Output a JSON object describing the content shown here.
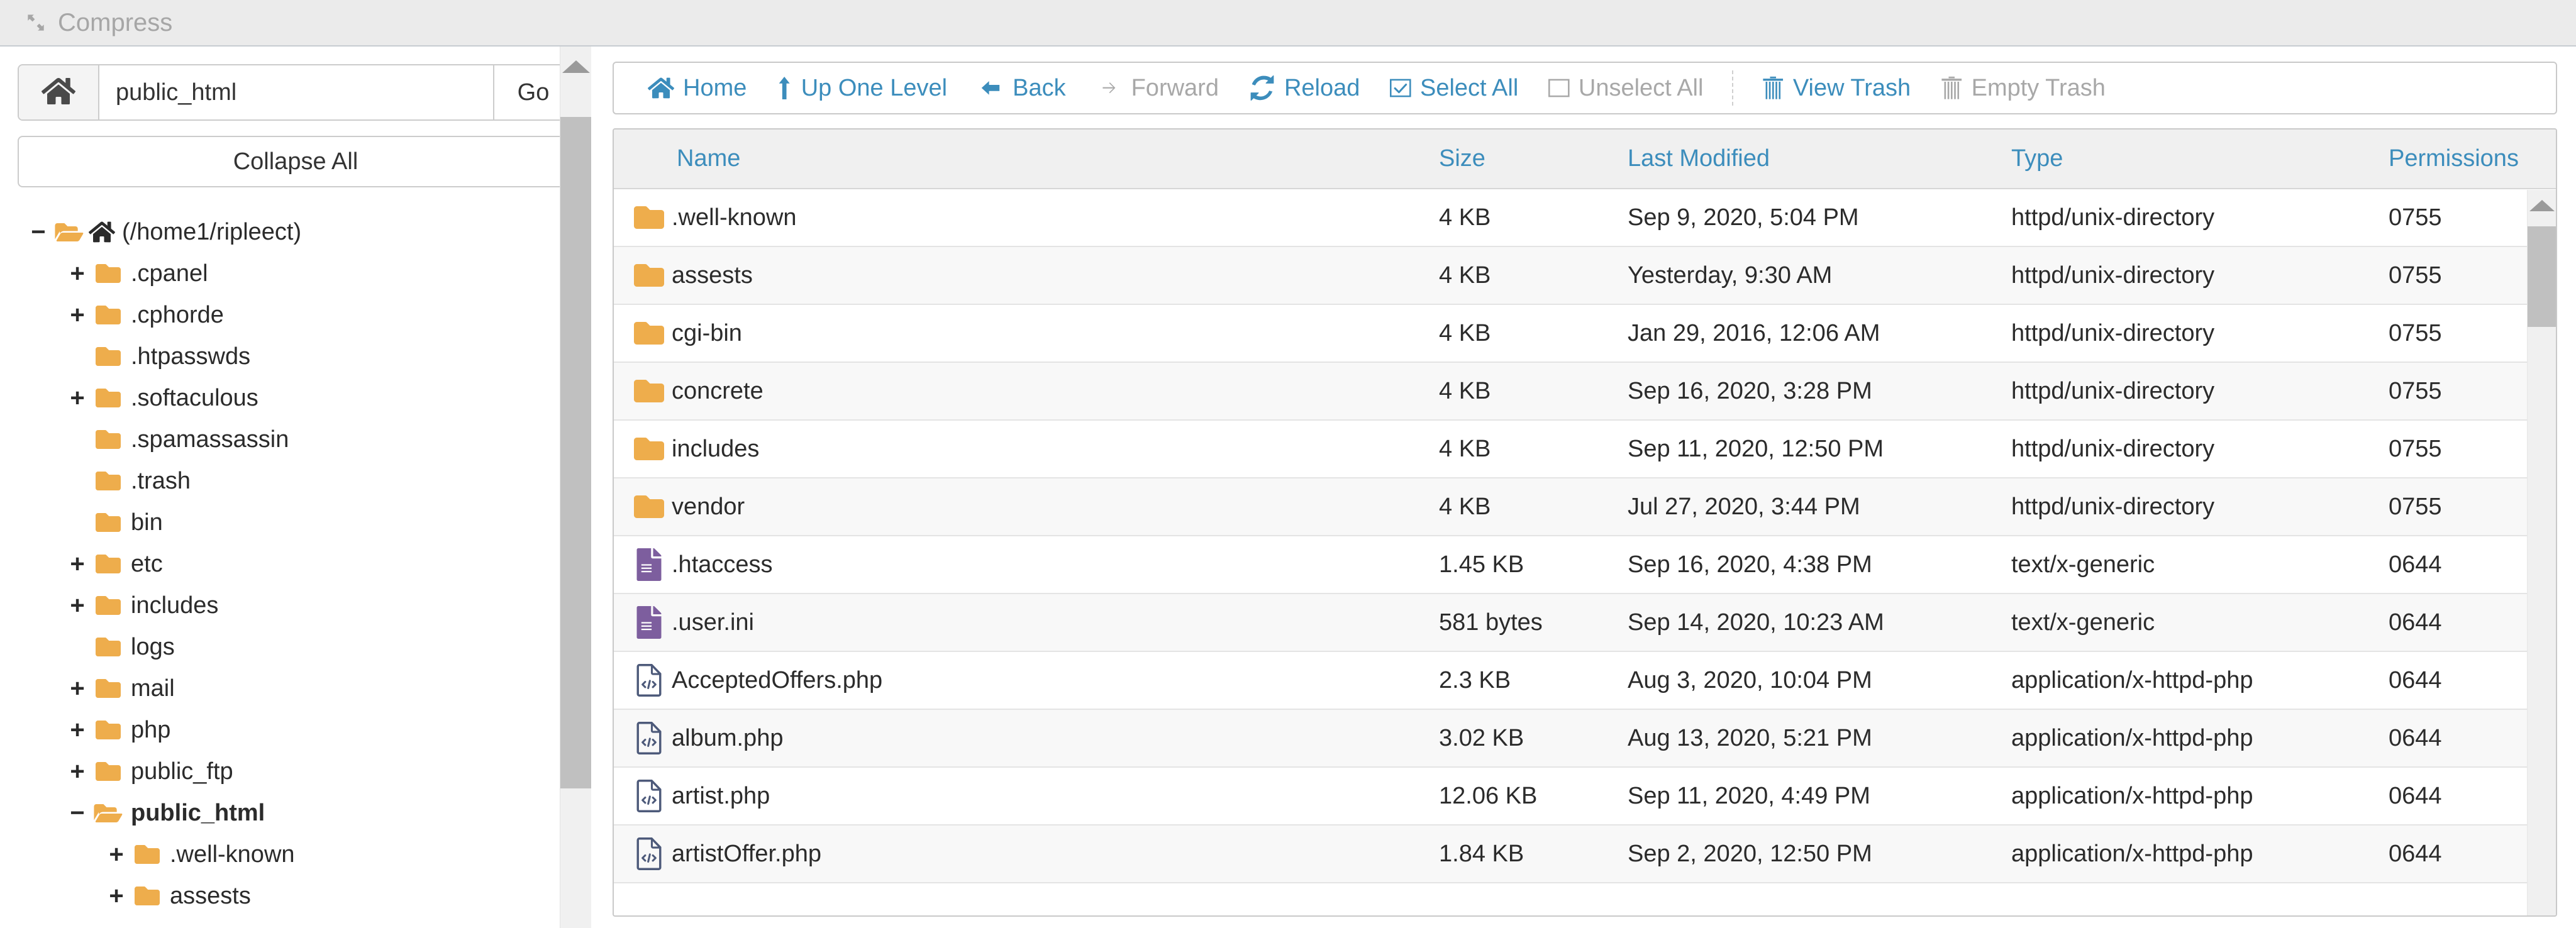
{
  "topbar": {
    "compress_label": "Compress",
    "compress_icon": "compress-arrows-icon",
    "disabled": true
  },
  "sidebar": {
    "path_input_value": "public_html",
    "path_input_placeholder": "public_html",
    "home_button_icon": "home-icon",
    "go_button_label": "Go",
    "collapse_all_label": "Collapse All",
    "tree": [
      {
        "label": "(/home1/ripleect)",
        "depth": 0,
        "toggle": "minus",
        "icon": "folder-open-icon",
        "extra_icon": "home-icon",
        "bold": false
      },
      {
        "label": ".cpanel",
        "depth": 1,
        "toggle": "plus",
        "icon": "folder-icon",
        "bold": false
      },
      {
        "label": ".cphorde",
        "depth": 1,
        "toggle": "plus",
        "icon": "folder-icon",
        "bold": false
      },
      {
        "label": ".htpasswds",
        "depth": 1,
        "toggle": "none",
        "icon": "folder-icon",
        "bold": false
      },
      {
        "label": ".softaculous",
        "depth": 1,
        "toggle": "plus",
        "icon": "folder-icon",
        "bold": false
      },
      {
        "label": ".spamassassin",
        "depth": 1,
        "toggle": "none",
        "icon": "folder-icon",
        "bold": false
      },
      {
        "label": ".trash",
        "depth": 1,
        "toggle": "none",
        "icon": "folder-icon",
        "bold": false
      },
      {
        "label": "bin",
        "depth": 1,
        "toggle": "none",
        "icon": "folder-icon",
        "bold": false
      },
      {
        "label": "etc",
        "depth": 1,
        "toggle": "plus",
        "icon": "folder-icon",
        "bold": false
      },
      {
        "label": "includes",
        "depth": 1,
        "toggle": "plus",
        "icon": "folder-icon",
        "bold": false
      },
      {
        "label": "logs",
        "depth": 1,
        "toggle": "none",
        "icon": "folder-icon",
        "bold": false
      },
      {
        "label": "mail",
        "depth": 1,
        "toggle": "plus",
        "icon": "folder-icon",
        "bold": false
      },
      {
        "label": "php",
        "depth": 1,
        "toggle": "plus",
        "icon": "folder-icon",
        "bold": false
      },
      {
        "label": "public_ftp",
        "depth": 1,
        "toggle": "plus",
        "icon": "folder-icon",
        "bold": false
      },
      {
        "label": "public_html",
        "depth": 1,
        "toggle": "minus",
        "icon": "folder-open-icon",
        "bold": true
      },
      {
        "label": ".well-known",
        "depth": 2,
        "toggle": "plus",
        "icon": "folder-icon",
        "bold": false
      },
      {
        "label": "assests",
        "depth": 2,
        "toggle": "plus",
        "icon": "folder-icon",
        "bold": false
      }
    ]
  },
  "toolbar": {
    "items": [
      {
        "label": "Home",
        "icon": "home-icon",
        "disabled": false
      },
      {
        "label": "Up One Level",
        "icon": "arrow-up-icon",
        "disabled": false
      },
      {
        "label": "Back",
        "icon": "arrow-left-icon",
        "disabled": false
      },
      {
        "label": "Forward",
        "icon": "arrow-right-icon",
        "disabled": true
      },
      {
        "label": "Reload",
        "icon": "reload-icon",
        "disabled": false
      },
      {
        "label": "Select All",
        "icon": "checkbox-checked-icon",
        "disabled": false
      },
      {
        "label": "Unselect All",
        "icon": "checkbox-empty-icon",
        "disabled": true
      },
      {
        "label": "View Trash",
        "icon": "trash-icon",
        "disabled": false
      },
      {
        "label": "Empty Trash",
        "icon": "trash-icon",
        "disabled": true
      }
    ],
    "separator_after_index": 6
  },
  "file_table": {
    "columns": [
      "Name",
      "Size",
      "Last Modified",
      "Type",
      "Permissions"
    ],
    "rows": [
      {
        "icon": "folder-icon",
        "name": ".well-known",
        "size": "4 KB",
        "modified": "Sep 9, 2020, 5:04 PM",
        "type": "httpd/unix-directory",
        "permissions": "0755"
      },
      {
        "icon": "folder-icon",
        "name": "assests",
        "size": "4 KB",
        "modified": "Yesterday, 9:30 AM",
        "type": "httpd/unix-directory",
        "permissions": "0755"
      },
      {
        "icon": "folder-icon",
        "name": "cgi-bin",
        "size": "4 KB",
        "modified": "Jan 29, 2016, 12:06 AM",
        "type": "httpd/unix-directory",
        "permissions": "0755"
      },
      {
        "icon": "folder-icon",
        "name": "concrete",
        "size": "4 KB",
        "modified": "Sep 16, 2020, 3:28 PM",
        "type": "httpd/unix-directory",
        "permissions": "0755"
      },
      {
        "icon": "folder-icon",
        "name": "includes",
        "size": "4 KB",
        "modified": "Sep 11, 2020, 12:50 PM",
        "type": "httpd/unix-directory",
        "permissions": "0755"
      },
      {
        "icon": "folder-icon",
        "name": "vendor",
        "size": "4 KB",
        "modified": "Jul 27, 2020, 3:44 PM",
        "type": "httpd/unix-directory",
        "permissions": "0755"
      },
      {
        "icon": "text-file-icon",
        "name": ".htaccess",
        "size": "1.45 KB",
        "modified": "Sep 16, 2020, 4:38 PM",
        "type": "text/x-generic",
        "permissions": "0644"
      },
      {
        "icon": "text-file-icon",
        "name": ".user.ini",
        "size": "581 bytes",
        "modified": "Sep 14, 2020, 10:23 AM",
        "type": "text/x-generic",
        "permissions": "0644"
      },
      {
        "icon": "code-file-icon",
        "name": "AcceptedOffers.php",
        "size": "2.3 KB",
        "modified": "Aug 3, 2020, 10:04 PM",
        "type": "application/x-httpd-php",
        "permissions": "0644"
      },
      {
        "icon": "code-file-icon",
        "name": "album.php",
        "size": "3.02 KB",
        "modified": "Aug 13, 2020, 5:21 PM",
        "type": "application/x-httpd-php",
        "permissions": "0644"
      },
      {
        "icon": "code-file-icon",
        "name": "artist.php",
        "size": "12.06 KB",
        "modified": "Sep 11, 2020, 4:49 PM",
        "type": "application/x-httpd-php",
        "permissions": "0644"
      },
      {
        "icon": "code-file-icon",
        "name": "artistOffer.php",
        "size": "1.84 KB",
        "modified": "Sep 2, 2020, 12:50 PM",
        "type": "application/x-httpd-php",
        "permissions": "0644"
      }
    ]
  },
  "colors": {
    "accent_blue": "#3c8dbc",
    "folder_orange": "#eead4c",
    "text_file_purple": "#7d5e9e",
    "code_file_navy": "#4d5a7a",
    "disabled_grey": "#a8a8a8",
    "header_grey": "#f0f0f0"
  }
}
